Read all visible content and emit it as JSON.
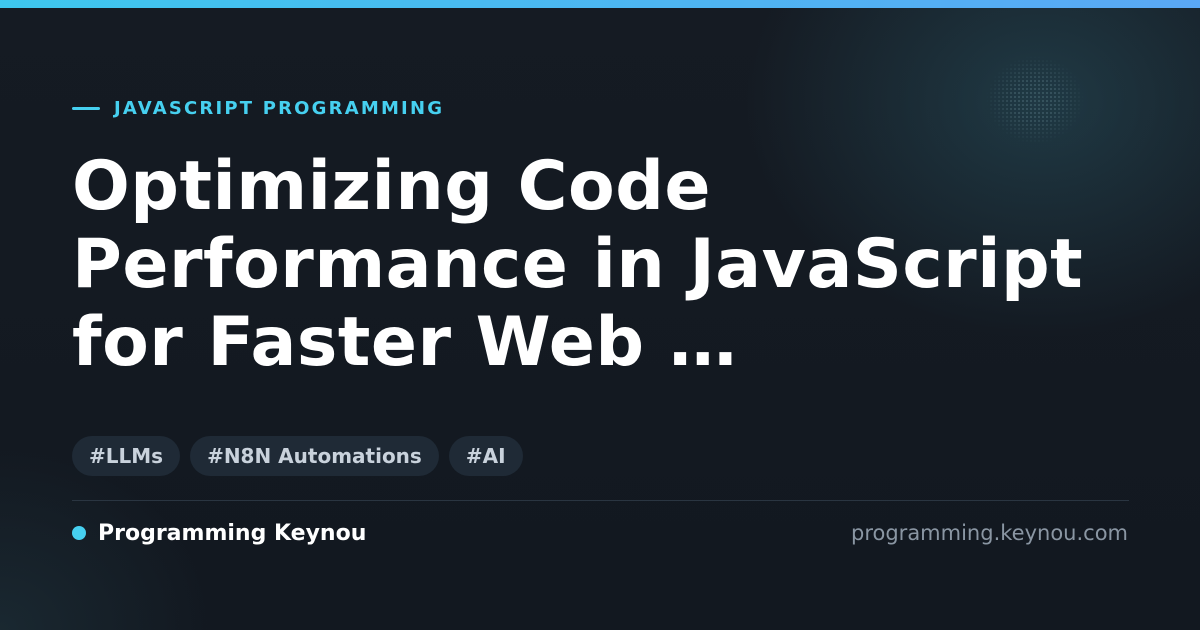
{
  "category": "JAVASCRIPT PROGRAMMING",
  "title": "Optimizing Code Performance in JavaScript for Faster Web …",
  "tags": [
    "#LLMs",
    "#N8N Automations",
    "#AI"
  ],
  "brand": {
    "name": "Programming Keynou"
  },
  "site_url": "programming.keynou.com",
  "colors": {
    "accent": "#46d0f0",
    "background": "#141a22",
    "tag_background": "#1f2a36",
    "title": "#ffffff",
    "muted": "#8a96a3"
  }
}
